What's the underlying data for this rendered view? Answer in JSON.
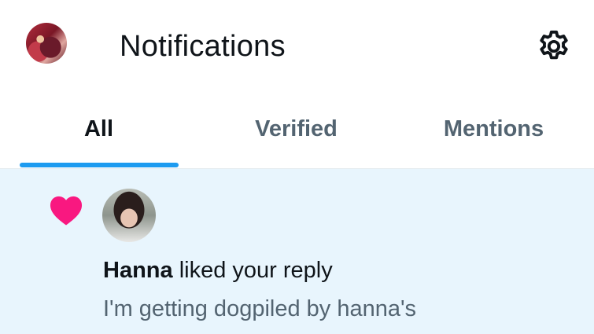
{
  "header": {
    "title": "Notifications",
    "settings_icon": "gear-icon",
    "profile_avatar": "profile-avatar"
  },
  "tabs": [
    {
      "label": "All",
      "active": true
    },
    {
      "label": "Verified",
      "active": false
    },
    {
      "label": "Mentions",
      "active": false
    }
  ],
  "notification": {
    "icon": "heart-icon",
    "user_name": "Hanna",
    "action_text": " liked your reply",
    "preview_text": "I'm getting dogpiled by hanna's"
  },
  "colors": {
    "accent": "#1d9bf0",
    "heart": "#f91880",
    "highlight_bg": "#e8f5fd",
    "secondary_text": "#536471"
  }
}
